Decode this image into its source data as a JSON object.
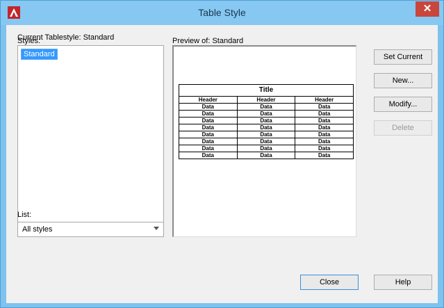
{
  "window": {
    "title": "Table Style"
  },
  "current_tablestyle_label": "Current Tablestyle: Standard",
  "styles": {
    "label": "Styles:",
    "items": [
      "Standard"
    ]
  },
  "list": {
    "label": "List:",
    "selected": "All styles"
  },
  "preview": {
    "label": "Preview of: Standard",
    "table": {
      "title": "Title",
      "headers": [
        "Header",
        "Header",
        "Header"
      ],
      "rows": [
        [
          "Data",
          "Data",
          "Data"
        ],
        [
          "Data",
          "Data",
          "Data"
        ],
        [
          "Data",
          "Data",
          "Data"
        ],
        [
          "Data",
          "Data",
          "Data"
        ],
        [
          "Data",
          "Data",
          "Data"
        ],
        [
          "Data",
          "Data",
          "Data"
        ],
        [
          "Data",
          "Data",
          "Data"
        ],
        [
          "Data",
          "Data",
          "Data"
        ]
      ]
    }
  },
  "buttons": {
    "set_current": "Set Current",
    "new": "New...",
    "modify": "Modify...",
    "delete": "Delete",
    "close": "Close",
    "help": "Help"
  },
  "colors": {
    "title_bar": "#86c8f1",
    "close_button": "#c9463d",
    "selection": "#3399ff",
    "app_icon": "#c0282d"
  }
}
